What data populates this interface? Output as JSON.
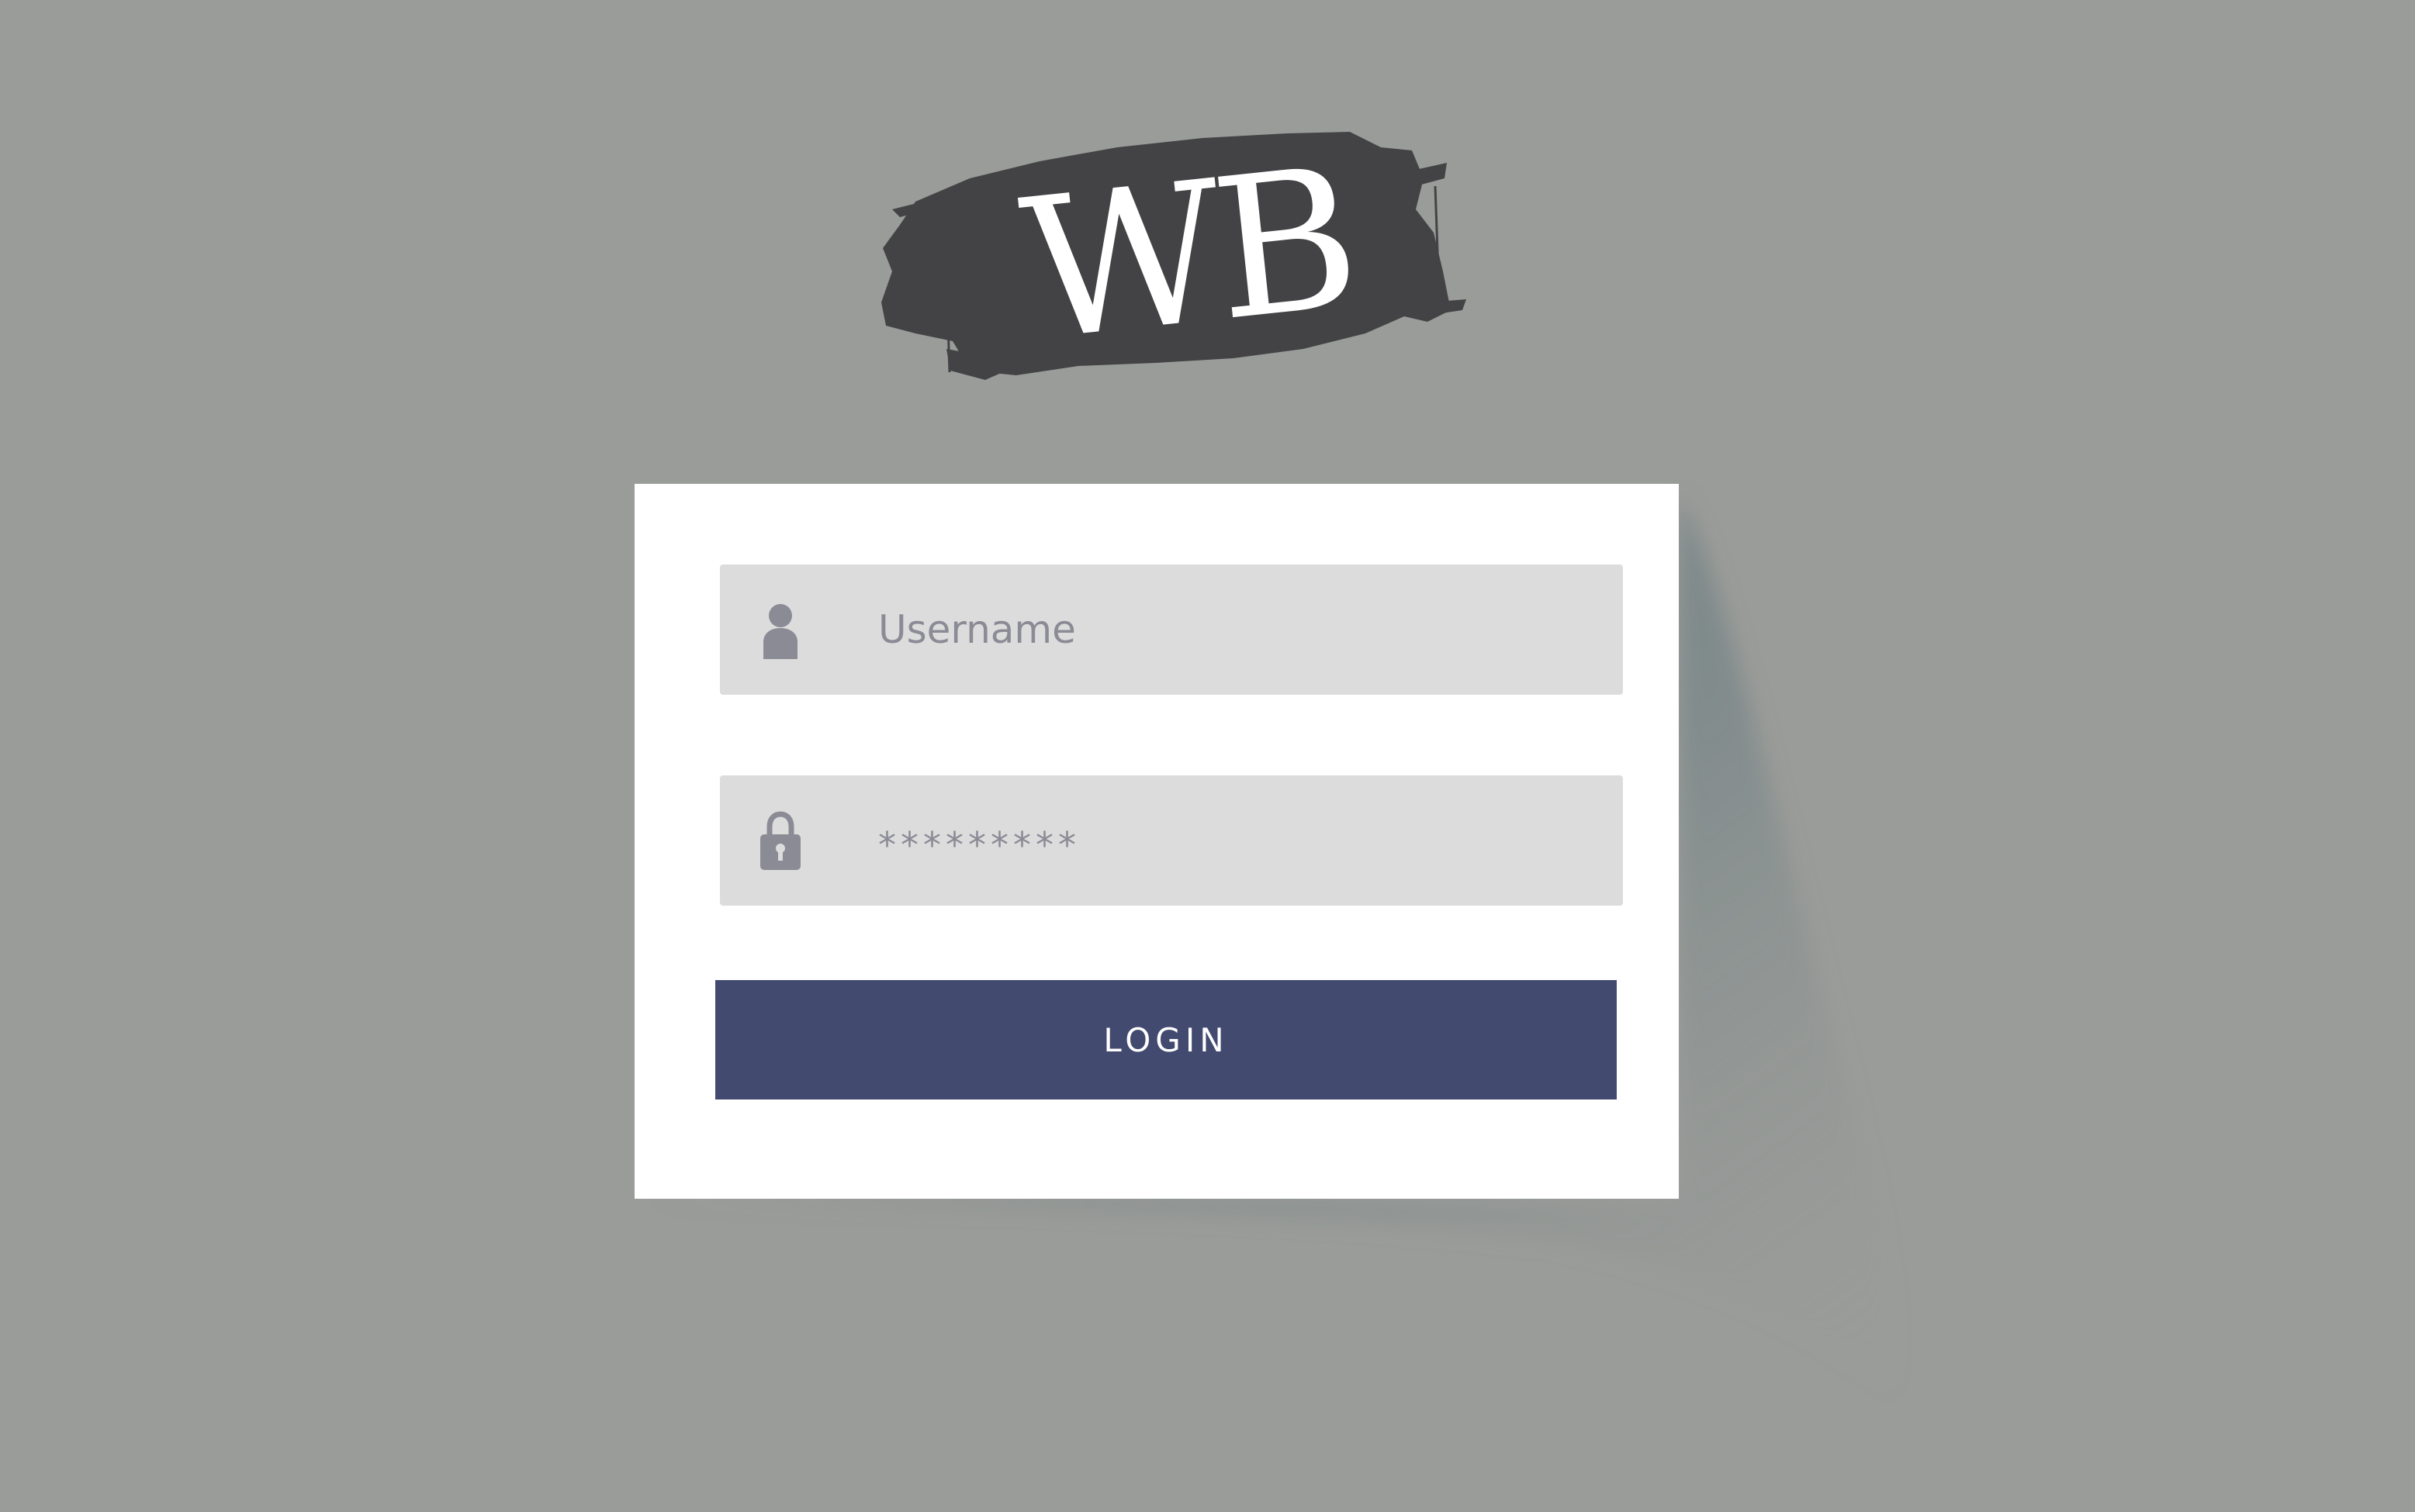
{
  "logo": {
    "text": "WB",
    "brush_color": "#434346",
    "text_color": "#ffffff"
  },
  "form": {
    "username": {
      "icon": "user-icon",
      "placeholder": "Username"
    },
    "password": {
      "icon": "lock-icon",
      "value": "*********"
    },
    "login_label": "LOGIN"
  },
  "colors": {
    "background": "#9a9c99",
    "card": "#ffffff",
    "field": "#dcdcdc",
    "field_text": "#8b8b96",
    "button": "#434a6f"
  }
}
